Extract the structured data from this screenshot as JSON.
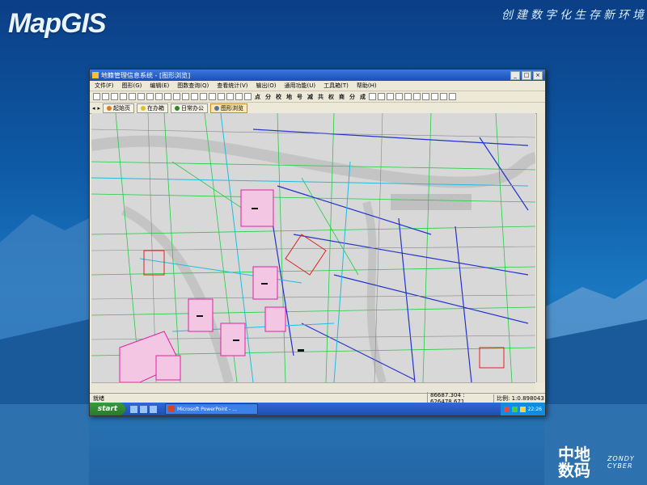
{
  "brand": {
    "logo_text": "MapGIS",
    "slogan": "创建数字化生存新环境",
    "corner_zh": "中地数码",
    "corner_en": "ZONDY CYBER"
  },
  "window": {
    "title": "地籍管理信息系统 - [图形浏览]",
    "menu": [
      "文件(F)",
      "图形(G)",
      "编辑(E)",
      "图数查询(Q)",
      "查看统计(V)",
      "输出(O)",
      "通用功能(U)",
      "工具箱(T)",
      "帮助(H)"
    ],
    "toolbar_words": [
      "点",
      "分",
      "校",
      "地",
      "号",
      "减",
      "共",
      "权",
      "商",
      "分",
      "成"
    ],
    "tabs": [
      {
        "label": "起始页",
        "color": "#e07a1a"
      },
      {
        "label": "在办箱",
        "color": "#e0c020"
      },
      {
        "label": "日常办公",
        "color": "#2a8a2a"
      },
      {
        "label": "图形浏览",
        "color": "#5577aa"
      }
    ],
    "status": {
      "ready": "就绪",
      "coordinates": "86687.304 : 626478.671",
      "scale": "比例: 1:0.898043"
    }
  },
  "taskbar": {
    "start": "start",
    "task": "Microsoft PowerPoint - ...",
    "time": "22:26"
  },
  "colors": {
    "bg": "#0f5aa6",
    "map_bg": "#d8d8d8",
    "parcel_pink": "#e020a0"
  }
}
